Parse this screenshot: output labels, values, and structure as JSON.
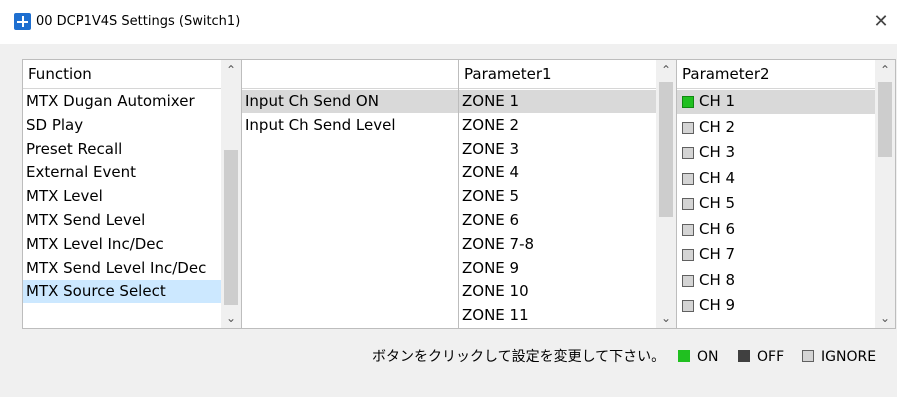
{
  "window": {
    "title": "00 DCP1V4S Settings (Switch1)",
    "close_glyph": "✕"
  },
  "function_column": {
    "header": "Function",
    "items": [
      "MTX Dugan Automixer",
      "SD Play",
      "Preset Recall",
      "External Event",
      "MTX Level",
      "MTX Send Level",
      "MTX Level Inc/Dec",
      "MTX Send Level Inc/Dec",
      "MTX Source Select"
    ],
    "selected": "MTX Source Select"
  },
  "sub_column": {
    "header": "",
    "items": [
      "Input Ch Send ON",
      "Input Ch Send Level"
    ],
    "selected": "Input Ch Send ON"
  },
  "parameter1": {
    "header": "Parameter1",
    "items": [
      "ZONE 1",
      "ZONE 2",
      "ZONE 3",
      "ZONE 4",
      "ZONE 5",
      "ZONE 6",
      "ZONE 7-8",
      "ZONE 9",
      "ZONE 10",
      "ZONE 11"
    ],
    "selected": "ZONE 1"
  },
  "parameter2": {
    "header": "Parameter2",
    "items": [
      {
        "label": "CH 1",
        "state": "ON"
      },
      {
        "label": "CH 2",
        "state": "IGNORE"
      },
      {
        "label": "CH 3",
        "state": "IGNORE"
      },
      {
        "label": "CH 4",
        "state": "IGNORE"
      },
      {
        "label": "CH 5",
        "state": "IGNORE"
      },
      {
        "label": "CH 6",
        "state": "IGNORE"
      },
      {
        "label": "CH 7",
        "state": "IGNORE"
      },
      {
        "label": "CH 8",
        "state": "IGNORE"
      },
      {
        "label": "CH 9",
        "state": "IGNORE"
      }
    ],
    "selected": "CH 1"
  },
  "footer": {
    "instruction": "ボタンをクリックして設定を変更して下さい。",
    "legend": [
      {
        "label": "ON",
        "color": "#20c020"
      },
      {
        "label": "OFF",
        "color": "#404040"
      },
      {
        "label": "IGNORE",
        "color": "#d4d4d4"
      }
    ]
  },
  "colors": {
    "selection_blue": "#cce8ff",
    "selection_gray": "#d9d9d9",
    "accent_icon": "#1e6fd0"
  }
}
